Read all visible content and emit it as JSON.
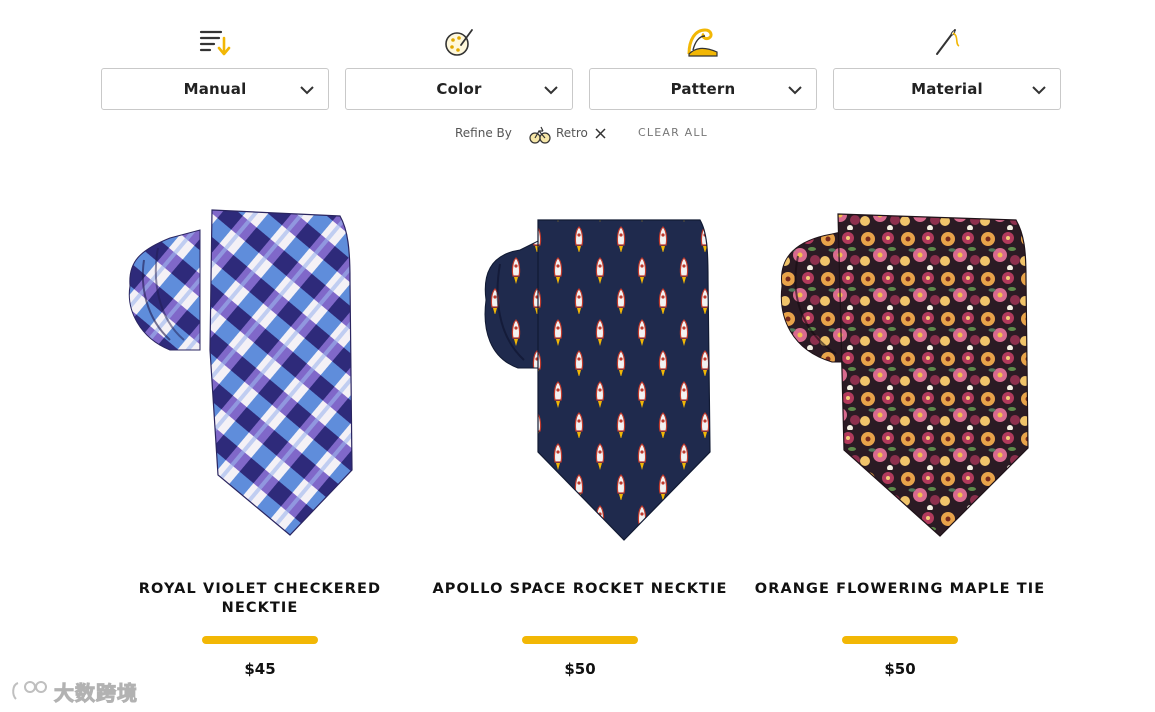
{
  "filters": [
    {
      "label": "Manual",
      "icon": "sort-icon"
    },
    {
      "label": "Color",
      "icon": "color-palette-icon"
    },
    {
      "label": "Pattern",
      "icon": "wave-pattern-icon"
    },
    {
      "label": "Material",
      "icon": "needle-thread-icon"
    }
  ],
  "refine": {
    "label": "Refine By",
    "chip": {
      "label": "Retro",
      "icon": "retro-bicycle-icon"
    },
    "clear_all": "CLEAR ALL"
  },
  "products": [
    {
      "name": "ROYAL VIOLET CHECKERED NECKTIE",
      "price": "$45",
      "pattern": "checkered"
    },
    {
      "name": "APOLLO SPACE ROCKET NECKTIE",
      "price": "$50",
      "pattern": "rockets"
    },
    {
      "name": "ORANGE FLOWERING MAPLE TIE",
      "price": "$50",
      "pattern": "floral"
    }
  ],
  "watermark": {
    "text": "大数跨境"
  },
  "colors": {
    "accent": "#f2b705",
    "border": "#c9c9c9"
  }
}
